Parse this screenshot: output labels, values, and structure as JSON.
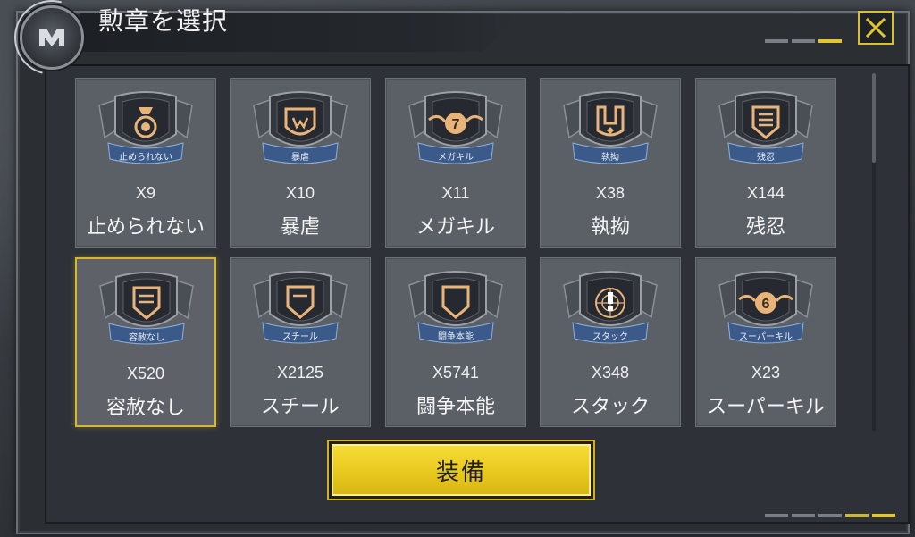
{
  "window": {
    "title": "勲章を選択"
  },
  "medals": [
    {
      "count": "X9",
      "name": "止められない",
      "ribbon": "止められない",
      "glyph": "gear-medal-icon"
    },
    {
      "count": "X10",
      "name": "暴虐",
      "ribbon": "暴虐",
      "glyph": "claw-shield-icon"
    },
    {
      "count": "X11",
      "name": "メガキル",
      "ribbon": "メガキル",
      "glyph": "winged-seven-icon",
      "emblem_text": "7"
    },
    {
      "count": "X38",
      "name": "執拗",
      "ribbon": "執拗",
      "glyph": "u-shield-icon"
    },
    {
      "count": "X144",
      "name": "残忍",
      "ribbon": "残忍",
      "glyph": "striped-shield-icon"
    },
    {
      "count": "X520",
      "name": "容赦なし",
      "ribbon": "容赦なし",
      "glyph": "double-bar-shield-icon",
      "selected": true
    },
    {
      "count": "X2125",
      "name": "スチール",
      "ribbon": "スチール",
      "glyph": "single-bar-shield-icon"
    },
    {
      "count": "X5741",
      "name": "闘争本能",
      "ribbon": "闘争本能",
      "glyph": "plain-shield-icon"
    },
    {
      "count": "X348",
      "name": "スタック",
      "ribbon": "スタック",
      "glyph": "exclamation-web-icon"
    },
    {
      "count": "X23",
      "name": "スーパーキル",
      "ribbon": "スーパーキル",
      "glyph": "winged-six-icon",
      "emblem_text": "6"
    }
  ],
  "equip_button": {
    "label": "装備"
  },
  "colors": {
    "accent": "#e8c81e",
    "selected_border": "#d8b730",
    "card_bg": "#5b6066",
    "badge_gold": "#e0a866",
    "ribbon_blue": "#3b5a8a"
  }
}
